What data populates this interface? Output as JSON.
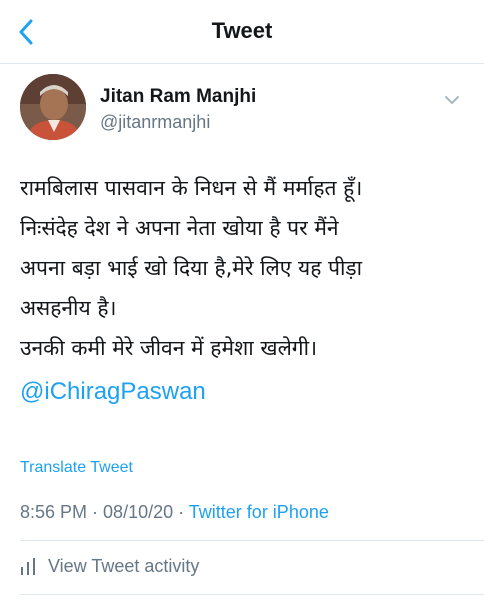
{
  "header": {
    "title": "Tweet",
    "back_icon": "chevron-left-icon"
  },
  "author": {
    "name": "Jitan Ram Manjhi",
    "handle": "@jitanrmanjhi",
    "more_icon": "chevron-down-icon"
  },
  "tweet": {
    "lines": [
      "रामबिलास पासवान के निधन से मैं मर्माहत हूँ।",
      "निःसंदेह देश ने अपना नेता खोया है पर मैंने",
      "अपना बड़ा भाई खो दिया है,मेरे लिए यह पीड़ा",
      "असहनीय है।",
      "उनकी कमी मेरे जीवन में हमेशा खलेगी।"
    ],
    "mention": "@iChiragPaswan",
    "translate_label": "Translate Tweet"
  },
  "meta": {
    "time": "8:56 PM",
    "separator": " · ",
    "date": "08/10/20",
    "source": "Twitter for iPhone"
  },
  "activity": {
    "label": "View Tweet activity",
    "icon": "bar-chart-icon"
  },
  "colors": {
    "accent": "#1da1f2",
    "secondary_text": "#657786",
    "divider": "#e1e8ed"
  }
}
